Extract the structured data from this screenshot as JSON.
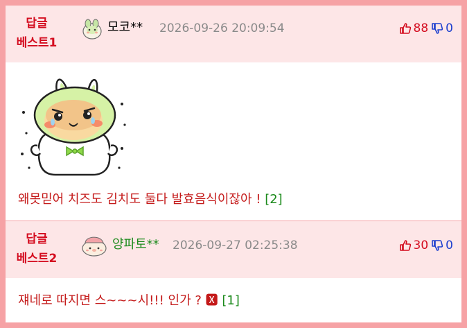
{
  "comments": [
    {
      "badge_line1": "답글",
      "badge_line2": "베스트1",
      "nickname": "모코**",
      "nickname_color": "#000000",
      "date": "2026-09-26 20:09:54",
      "upvotes": "88",
      "downvotes": "0",
      "text": "왜못믿어 치즈도 김치도 둘다 발효음식이잖아 !",
      "reply_count": "[2]",
      "has_sticker": true,
      "avatar_icon": "green-creature-avatar-icon",
      "sticker_icon": "green-bunny-hood-character-sticker-icon"
    },
    {
      "badge_line1": "답글",
      "badge_line2": "베스트2",
      "nickname": "양파토**",
      "nickname_color": "#1b8a1b",
      "date": "2026-09-27 02:25:38",
      "upvotes": "30",
      "downvotes": "0",
      "text": "쟤네로 따지면 스~~~시!!! 인가 ? 🆇",
      "reply_count": "[1]",
      "has_sticker": false,
      "avatar_icon": "pink-creature-avatar-icon"
    }
  ],
  "colors": {
    "border": "#f6a2a5",
    "header_bg": "#fde6e7",
    "badge": "#d40c1f",
    "comment_text": "#c41a1a",
    "reply_count": "#1b8a1b",
    "upvote": "#d40c1f",
    "downvote": "#1d3fcf",
    "date": "#8a8a8a"
  }
}
